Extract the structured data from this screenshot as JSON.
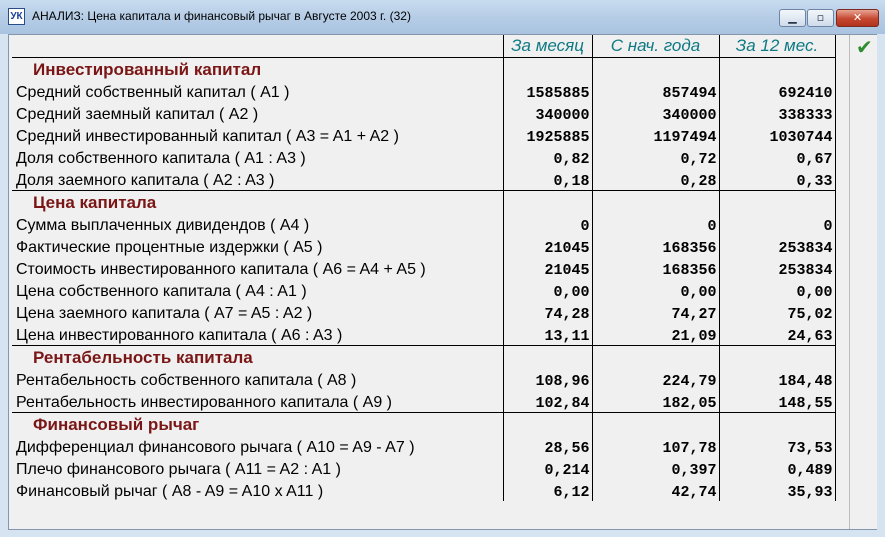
{
  "window": {
    "title": "АНАЛИЗ: Цена капитала и финансовый рычаг в Августе 2003 г. (32)",
    "app_icon_text": "УК",
    "icons": {
      "minimize": "minimize-icon",
      "maximize": "maximize-icon",
      "close": "close-icon",
      "ok": "checkmark-icon"
    }
  },
  "columns": [
    "За месяц",
    "С нач. года",
    "За 12 мес."
  ],
  "sections": [
    {
      "title": "Инвестированный капитал",
      "rows": [
        {
          "label": "Средний собственный капитал ( A1 )",
          "values": [
            "1585885",
            "857494",
            "692410"
          ]
        },
        {
          "label": "Средний заемный капитал ( A2 )",
          "values": [
            "340000",
            "340000",
            "338333"
          ]
        },
        {
          "label": "Средний инвестированный капитал ( A3 = A1 + A2 )",
          "values": [
            "1925885",
            "1197494",
            "1030744"
          ]
        },
        {
          "label": "Доля собственного капитала ( A1 : A3 )",
          "values": [
            "0,82",
            "0,72",
            "0,67"
          ]
        },
        {
          "label": "Доля заемного капитала ( A2 : A3 )",
          "values": [
            "0,18",
            "0,28",
            "0,33"
          ]
        }
      ]
    },
    {
      "title": "Цена капитала",
      "rows": [
        {
          "label": "Сумма выплаченных дивидендов ( A4 )",
          "values": [
            "0",
            "0",
            "0"
          ]
        },
        {
          "label": "Фактические процентные издержки ( A5 )",
          "values": [
            "21045",
            "168356",
            "253834"
          ]
        },
        {
          "label": "Стоимость инвестированного капитала ( A6 = A4 + A5 )",
          "values": [
            "21045",
            "168356",
            "253834"
          ]
        },
        {
          "label": "Цена собственного капитала ( A4 : A1 )",
          "values": [
            "0,00",
            "0,00",
            "0,00"
          ]
        },
        {
          "label": "Цена заемного капитала ( A7 = A5 : A2 )",
          "values": [
            "74,28",
            "74,27",
            "75,02"
          ]
        },
        {
          "label": "Цена инвестированного капитала ( A6 : A3 )",
          "values": [
            "13,11",
            "21,09",
            "24,63"
          ]
        }
      ]
    },
    {
      "title": "Рентабельность капитала",
      "rows": [
        {
          "label": "Рентабельность собственного капитала ( A8 )",
          "values": [
            "108,96",
            "224,79",
            "184,48"
          ]
        },
        {
          "label": "Рентабельность инвестированного капитала ( A9 )",
          "values": [
            "102,84",
            "182,05",
            "148,55"
          ]
        }
      ]
    },
    {
      "title": "Финансовый рычаг",
      "rows": [
        {
          "label": "Дифференциал финансового рычага ( A10 = A9 - A7 )",
          "values": [
            "28,56",
            "107,78",
            "73,53"
          ]
        },
        {
          "label": "Плечо финансового рычага ( A11 = A2 : A1 )",
          "values": [
            "0,214",
            "0,397",
            "0,489"
          ]
        },
        {
          "label": "Финансовый рычаг ( A8 - A9 = A10 x A11 )",
          "values": [
            "6,12",
            "42,74",
            "35,93"
          ]
        }
      ]
    }
  ]
}
